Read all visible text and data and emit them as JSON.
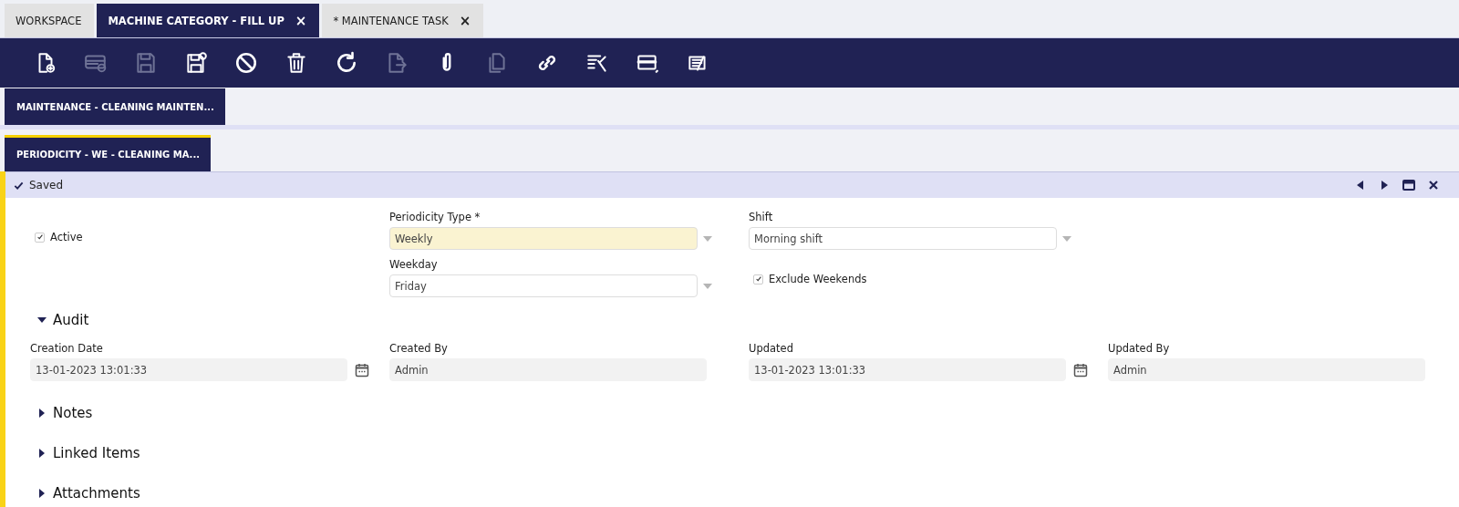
{
  "document_tabs": [
    {
      "label": "WORKSPACE",
      "selected": false,
      "closable": false
    },
    {
      "label": "MACHINE CATEGORY - FILL UP",
      "selected": true,
      "closable": true
    },
    {
      "label": "* MAINTENANCE TASK",
      "selected": false,
      "closable": true
    }
  ],
  "close_glyph": "×",
  "toolbar": [
    {
      "kind": "new-document",
      "disabled": false
    },
    {
      "kind": "new-row",
      "disabled": true
    },
    {
      "kind": "save",
      "disabled": true
    },
    {
      "kind": "save-close",
      "disabled": false
    },
    {
      "kind": "undo",
      "disabled": false
    },
    {
      "kind": "delete",
      "disabled": false
    },
    {
      "kind": "refresh",
      "disabled": false
    },
    {
      "kind": "export",
      "disabled": true
    },
    {
      "kind": "attach",
      "disabled": false
    },
    {
      "kind": "copy",
      "disabled": true
    },
    {
      "kind": "link",
      "disabled": false
    },
    {
      "kind": "tools",
      "disabled": false
    },
    {
      "kind": "form-view",
      "disabled": false
    },
    {
      "kind": "notes",
      "disabled": false
    }
  ],
  "record_tabs": [
    {
      "label": "MAINTENANCE - CLEANING MAINTEN...",
      "selected": false
    },
    {
      "label": "PERIODICITY - WE - CLEANING MA...",
      "selected": true
    }
  ],
  "status": {
    "text": "Saved"
  },
  "form_rows": [
    [
      {
        "kind": "checkbox",
        "label": "Active",
        "checked": true
      },
      {
        "kind": "select",
        "label": "Periodicity Type *",
        "value": "Weekly",
        "required": true
      },
      {
        "kind": "select",
        "label": "Shift",
        "value": "Morning shift",
        "required": false
      }
    ],
    [
      {
        "kind": "blank"
      },
      {
        "kind": "select",
        "label": "Weekday",
        "value": "Friday",
        "required": false
      },
      {
        "kind": "checkbox",
        "label": "Exclude Weekends",
        "checked": true
      }
    ]
  ],
  "sections": [
    {
      "title": "Audit",
      "expanded": true,
      "fields": [
        {
          "kind": "date",
          "label": "Creation Date",
          "value": "13-01-2023 13:01:33"
        },
        {
          "kind": "text",
          "label": "Created By",
          "value": "Admin"
        },
        {
          "kind": "date",
          "label": "Updated",
          "value": "13-01-2023 13:01:33"
        },
        {
          "kind": "text",
          "label": "Updated By",
          "value": "Admin"
        }
      ]
    },
    {
      "title": "Notes",
      "expanded": false
    },
    {
      "title": "Linked Items",
      "expanded": false
    },
    {
      "title": "Attachments",
      "expanded": false
    }
  ]
}
